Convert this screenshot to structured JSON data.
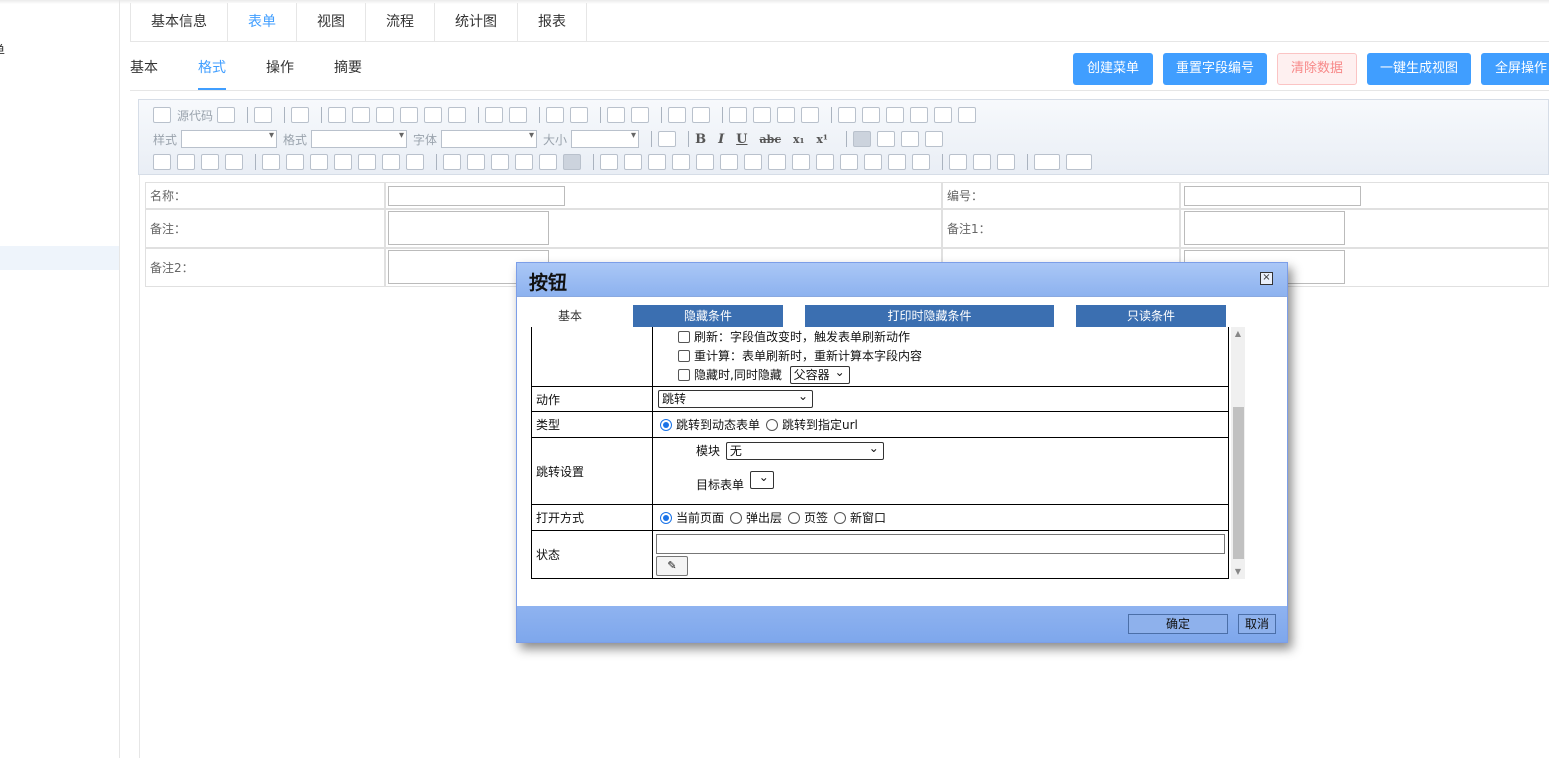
{
  "sidebar": {
    "partial_label": "单"
  },
  "top_tabs": [
    {
      "label": "基本信息",
      "active": false
    },
    {
      "label": "表单",
      "active": true
    },
    {
      "label": "视图",
      "active": false
    },
    {
      "label": "流程",
      "active": false
    },
    {
      "label": "统计图",
      "active": false
    },
    {
      "label": "报表",
      "active": false
    }
  ],
  "sub_tabs": [
    {
      "label": "基本",
      "active": false
    },
    {
      "label": "格式",
      "active": true
    },
    {
      "label": "操作",
      "active": false
    },
    {
      "label": "摘要",
      "active": false
    }
  ],
  "actions": {
    "create_menu": "创建菜单",
    "reset_field_no": "重置字段编号",
    "clear_data": "清除数据",
    "gen_view": "一键生成视图",
    "fullscreen": "全屏操作"
  },
  "editor_toolbar": {
    "source": "源代码",
    "style": "样式",
    "format": "格式",
    "font": "字体",
    "size": "大小",
    "bold": "B",
    "italic": "I",
    "underline": "U",
    "strike": "abc",
    "subscript": "x₁",
    "superscript": "x¹"
  },
  "form": {
    "name_label": "名称：",
    "code_label": "编号：",
    "remark_label": "备注：",
    "remark1_label": "备注1：",
    "remark2_label": "备注2："
  },
  "dialog": {
    "title": "按钮",
    "tabs": [
      {
        "label": "基本",
        "active": true
      },
      {
        "label": "隐藏条件",
        "active": false
      },
      {
        "label": "打印时隐藏条件",
        "active": false
      },
      {
        "label": "只读条件",
        "active": false
      }
    ],
    "options": {
      "refresh": "刷新：字段值改变时，触发表单刷新动作",
      "recalc": "重计算：表单刷新时，重新计算本字段内容",
      "hide_with": "隐藏时,同时隐藏",
      "hide_with_value": "父容器"
    },
    "action_label": "动作",
    "action_value": "跳转",
    "type_label": "类型",
    "type_options": [
      {
        "label": "跳转到动态表单",
        "checked": true
      },
      {
        "label": "跳转到指定url",
        "checked": false
      }
    ],
    "jump_label": "跳转设置",
    "module_label": "模块",
    "module_value": "无",
    "target_form_label": "目标表单",
    "open_label": "打开方式",
    "open_options": [
      {
        "label": "当前页面",
        "checked": true
      },
      {
        "label": "弹出层",
        "checked": false
      },
      {
        "label": "页签",
        "checked": false
      },
      {
        "label": "新窗口",
        "checked": false
      }
    ],
    "state_label": "状态",
    "ok_label": "确定",
    "cancel_label": "取消"
  }
}
